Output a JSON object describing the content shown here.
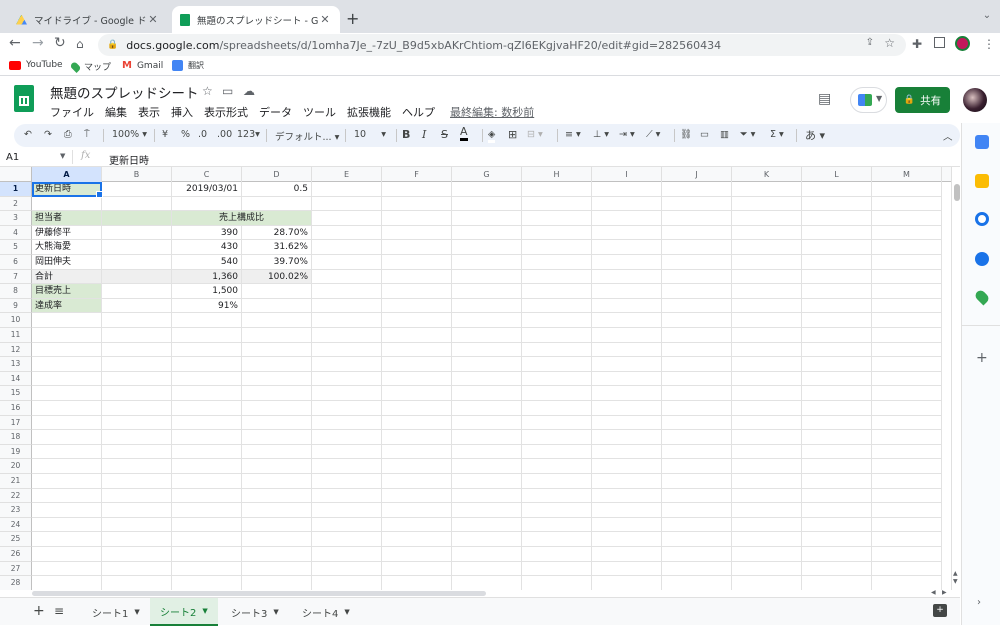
{
  "browser": {
    "tabs": [
      {
        "title": "マイドライブ - Google ドライブ",
        "active": false
      },
      {
        "title": "無題のスプレッドシート - Google",
        "active": true
      }
    ],
    "url_host": "docs.google.com",
    "url_path": "/spreadsheets/d/1omha7Je_-7zU_B9d5xbAKrChtiom-qZI6EKgjvaHF20/edit#gid=282560434",
    "bookmarks": [
      "YouTube",
      "マップ",
      "Gmail",
      "翻訳"
    ]
  },
  "doc": {
    "title": "無題のスプレッドシート",
    "menus": [
      "ファイル",
      "編集",
      "表示",
      "挿入",
      "表示形式",
      "データ",
      "ツール",
      "拡張機能",
      "ヘルプ"
    ],
    "last_edit": "最終編集: 数秒前",
    "share_label": "共有"
  },
  "toolbar": {
    "zoom": "100%",
    "currency": "¥",
    "percent": "%",
    "dec_less": ".0",
    "dec_more": ".00",
    "format_123": "123",
    "font": "デフォルト...",
    "font_size": "10",
    "ime": "あ"
  },
  "formula_bar": {
    "cell_ref": "A1",
    "fx": "fx",
    "content": "更新日時"
  },
  "grid": {
    "columns": [
      "A",
      "B",
      "C",
      "D",
      "E",
      "F",
      "G",
      "H",
      "I",
      "J",
      "K",
      "L",
      "M"
    ],
    "row_count": 28,
    "cells": {
      "A1": "更新日時",
      "C1": "2019/03/01",
      "D1": "0.5",
      "A3": "担当者",
      "C3": "売上構成比",
      "A4": "伊藤修平",
      "C4": "390",
      "D4": "28.70%",
      "A5": "大熊海愛",
      "C5": "430",
      "D5": "31.62%",
      "A6": "岡田伸夫",
      "C6": "540",
      "D6": "39.70%",
      "A7": "合計",
      "C7": "1,360",
      "D7": "100.02%",
      "A8": "目標売上",
      "C8": "1,500",
      "A9": "達成率",
      "C9": "91%"
    }
  },
  "sheets": [
    {
      "label": "シート1",
      "active": false
    },
    {
      "label": "シート2",
      "active": true
    },
    {
      "label": "シート3",
      "active": false
    },
    {
      "label": "シート4",
      "active": false
    }
  ],
  "colors": {
    "accent": "#188038",
    "selection": "#1a73e8",
    "header_fill": "#d9ead3"
  }
}
